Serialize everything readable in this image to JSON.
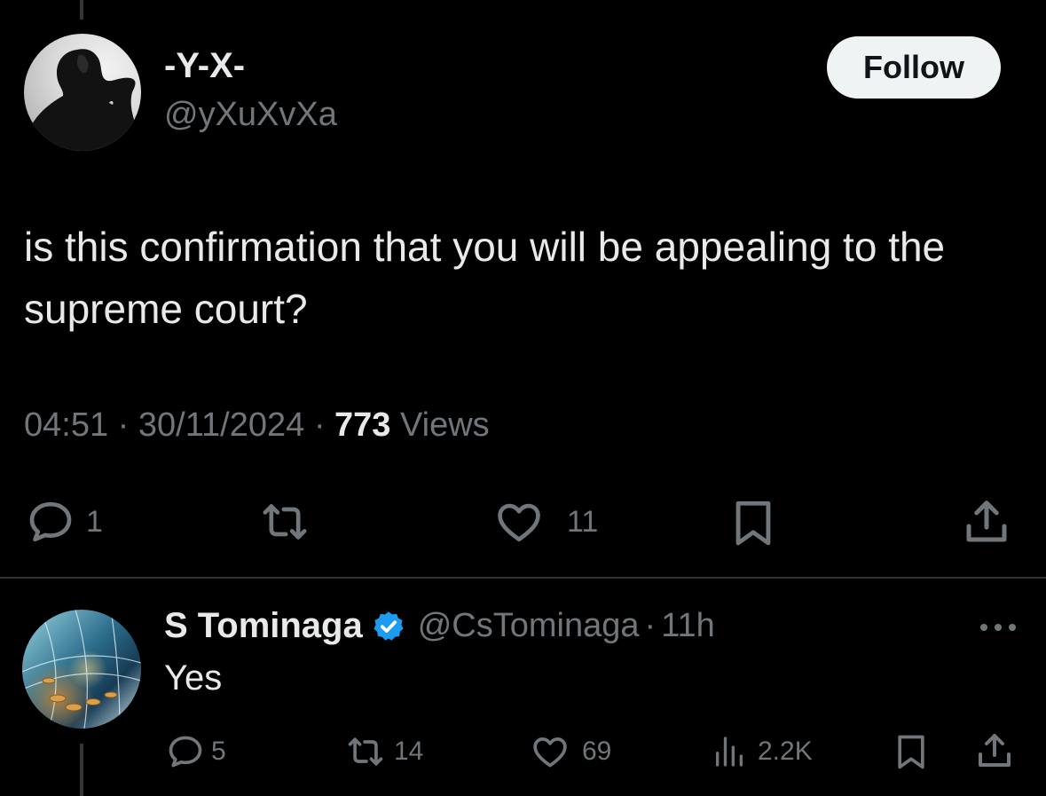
{
  "main_tweet": {
    "author": {
      "name": "-Y-X-",
      "handle": "@yXuXvXa"
    },
    "follow_label": "Follow",
    "text": "is this confirmation that you will be appealing to the supreme court?",
    "meta": {
      "time": "04:51",
      "separator": "·",
      "date": "30/11/2024",
      "views_count": "773",
      "views_label": "Views"
    },
    "actions": {
      "reply_count": "1",
      "retweet_count": "",
      "like_count": "11"
    }
  },
  "reply_tweet": {
    "author": {
      "name": "S Tominaga",
      "handle": "@CsTominaga",
      "verified": true
    },
    "separator": "·",
    "time": "11h",
    "text": "Yes",
    "actions": {
      "reply_count": "5",
      "retweet_count": "14",
      "like_count": "69",
      "views_count": "2.2K"
    }
  },
  "colors": {
    "background": "#000000",
    "text_primary": "#e7e9ea",
    "text_secondary": "#71767b",
    "divider": "#2f3336",
    "verified_badge": "#1d9bf0",
    "follow_button_bg": "#eff3f4",
    "follow_button_text": "#0f1419"
  },
  "icons": [
    "reply-icon",
    "retweet-icon",
    "like-icon",
    "bookmark-icon",
    "share-icon",
    "views-icon",
    "verified-icon",
    "more-icon"
  ]
}
